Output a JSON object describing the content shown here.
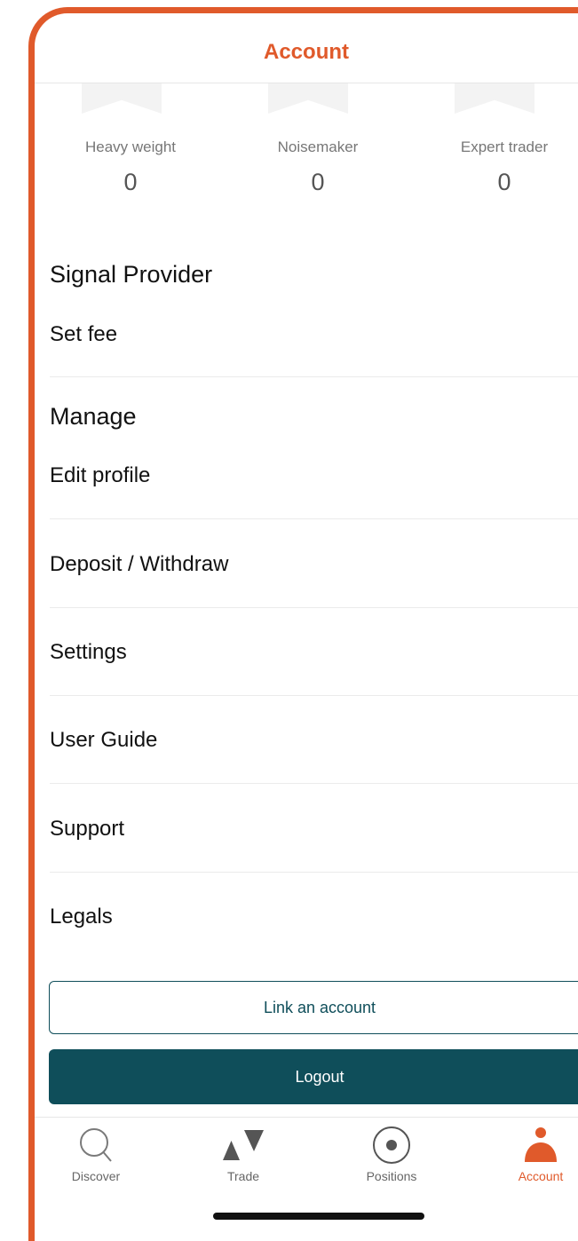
{
  "header": {
    "title": "Account"
  },
  "badges": [
    {
      "label": "Heavy weight",
      "count": "0"
    },
    {
      "label": "Noisemaker",
      "count": "0"
    },
    {
      "label": "Expert trader",
      "count": "0"
    }
  ],
  "sections": {
    "signal_provider": {
      "title": "Signal Provider",
      "items": [
        "Set fee"
      ]
    },
    "manage": {
      "title": "Manage",
      "items": [
        "Edit profile",
        "Deposit / Withdraw",
        "Settings",
        "User Guide",
        "Support",
        "Legals"
      ]
    }
  },
  "buttons": {
    "link_account": "Link an account",
    "logout": "Logout"
  },
  "tabs": [
    {
      "label": "Discover",
      "icon": "search-icon"
    },
    {
      "label": "Trade",
      "icon": "trade-icon"
    },
    {
      "label": "Positions",
      "icon": "positions-icon"
    },
    {
      "label": "Account",
      "icon": "account-icon",
      "active": true
    }
  ],
  "colors": {
    "accent": "#e05a2b",
    "primary": "#0f4e5a"
  }
}
